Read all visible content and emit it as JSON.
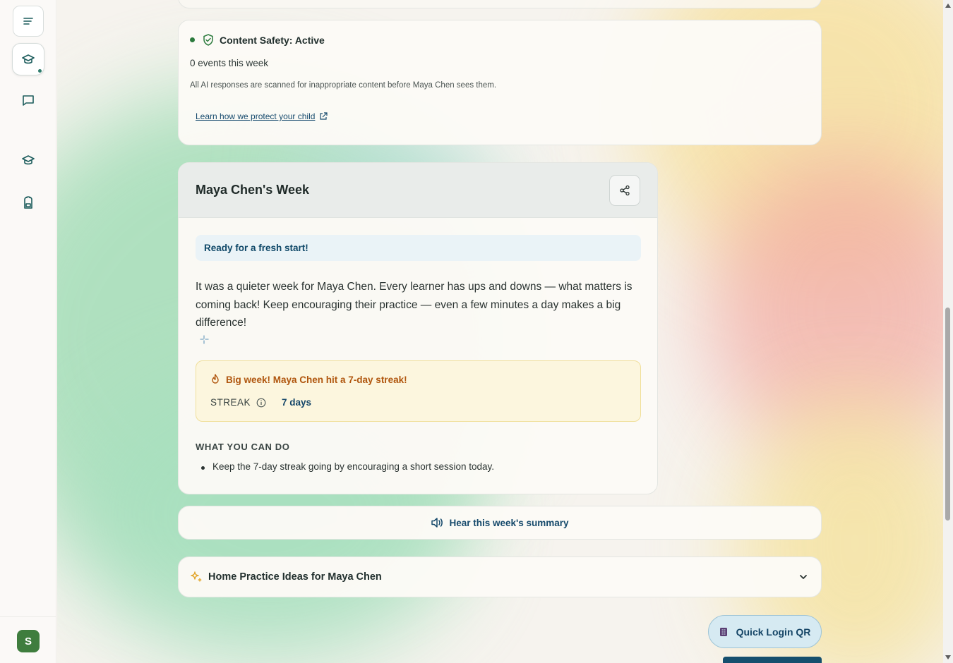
{
  "safety": {
    "status": "Content Safety: Active",
    "events": "0 events this week",
    "description": "All AI responses are scanned for inappropriate content before Maya Chen sees them.",
    "link": "Learn how we protect your child"
  },
  "week": {
    "title": "Maya Chen's Week",
    "ready": "Ready for a fresh start!",
    "summary": "It was a quieter week for Maya Chen. Every learner has ups and downs — what matters is coming back! Keep encouraging their practice — even a few minutes a day makes a big difference!",
    "streak_title": "Big week! Maya Chen hit a 7-day streak!",
    "streak_label": "STREAK",
    "streak_value": "7 days",
    "actions_heading": "WHAT YOU CAN DO",
    "actions": [
      "Keep the 7-day streak going by encouraging a short session today."
    ]
  },
  "hear": {
    "label": "Hear this week's summary"
  },
  "practice": {
    "label": "Home Practice Ideas for Maya Chen"
  },
  "quick_login": {
    "label": "Quick Login QR"
  },
  "user": {
    "initial": "S"
  },
  "colors": {
    "accent": "#15496b",
    "success": "#2b7a3d",
    "warning_text": "#b0560e"
  }
}
